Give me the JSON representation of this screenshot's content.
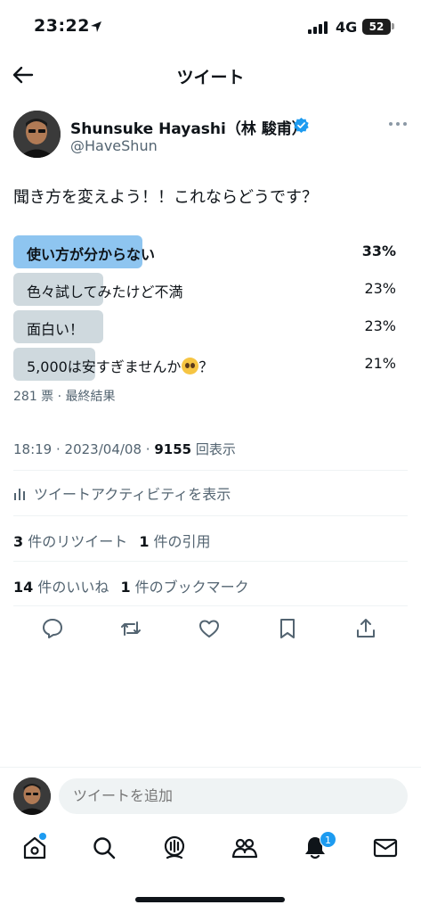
{
  "status": {
    "time": "23:22",
    "network": "4G",
    "battery": "52",
    "icons": [
      "location-arrow-icon",
      "signal-icon",
      "battery-icon"
    ]
  },
  "header": {
    "title": "ツイート",
    "back_icon": "arrow-left-icon"
  },
  "author": {
    "name": "Shunsuke Hayashi（林 駿甫）",
    "handle": "@HaveShun",
    "verified_icon": "verified-badge-icon",
    "more_icon": "more-horizontal-icon"
  },
  "tweet": {
    "text": "聞き方を変えよう！！これならどうです？"
  },
  "poll": {
    "options": [
      {
        "label": "使い方が分からない",
        "percent": "33%",
        "share": 0.33,
        "winner": true
      },
      {
        "label": "色々試してみたけど不満",
        "percent": "23%",
        "share": 0.23,
        "winner": false
      },
      {
        "label": "面白い！",
        "percent": "23%",
        "share": 0.23,
        "winner": false
      },
      {
        "label": "5,000は安すぎませんか",
        "suffix": "？",
        "percent": "21%",
        "share": 0.21,
        "winner": false,
        "emoji": "pleading-face-emoji"
      }
    ],
    "meta": "281 票 · 最終結果"
  },
  "meta": {
    "time": "18:19",
    "sep": " · ",
    "date": "2023/04/08",
    "views": "9155",
    "views_label": " 回表示"
  },
  "activity": {
    "label": "ツイートアクティビティを表示"
  },
  "stats": {
    "retweets": "3",
    "retweets_label": " 件のリツイート",
    "quotes": "1",
    "quotes_label": " 件の引用",
    "likes": "14",
    "likes_label": " 件のいいね",
    "bookmarks": "1",
    "bookmarks_label": " 件のブックマーク"
  },
  "actions": [
    "reply-icon",
    "retweet-icon",
    "like-icon",
    "bookmark-icon",
    "share-icon"
  ],
  "reply": {
    "placeholder": "ツイートを追加"
  },
  "tabbar": {
    "items": [
      "home-icon",
      "search-icon",
      "spaces-icon",
      "communities-icon",
      "notifications-icon",
      "messages-icon"
    ],
    "notif_badge": "1",
    "accent": "#1d9bf0"
  },
  "colors": {
    "poll_winner": "#8ec5f0",
    "poll_other": "#cfd9de",
    "verified": "#1d9bf0"
  }
}
